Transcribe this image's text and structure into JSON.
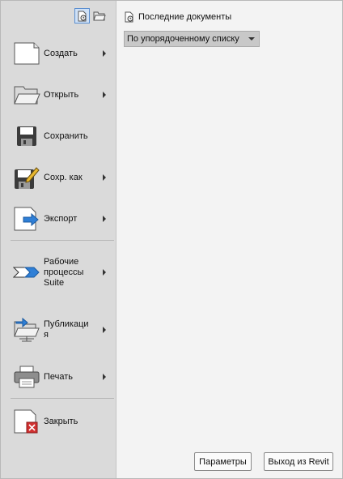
{
  "menu": {
    "items": [
      {
        "label": "Создать",
        "icon": "new-document-icon",
        "submenu": true
      },
      {
        "label": "Открыть",
        "icon": "open-folder-icon",
        "submenu": true
      },
      {
        "label": "Сохранить",
        "icon": "save-disk-icon",
        "submenu": false
      },
      {
        "label": "Сохр. как",
        "icon": "save-as-icon",
        "submenu": true
      },
      {
        "label": "Экспорт",
        "icon": "export-icon",
        "submenu": true
      },
      {
        "label": "Рабочие\nпроцессы\nSuite",
        "icon": "suite-workflows-icon",
        "submenu": true
      },
      {
        "label": "Публикаци\nя",
        "icon": "publish-icon",
        "submenu": true
      },
      {
        "label": "Печать",
        "icon": "printer-icon",
        "submenu": true
      },
      {
        "label": "Закрыть",
        "icon": "close-document-icon",
        "submenu": false
      }
    ]
  },
  "recent": {
    "title": "Последние документы",
    "sort_selected": "По упорядоченному списку"
  },
  "buttons": {
    "options": "Параметры",
    "exit": "Выход из Revit"
  },
  "colors": {
    "menu_bg": "#dadada",
    "pane_bg": "#f3f3f3",
    "accent_blue": "#2f7fd6",
    "close_red": "#d03030"
  }
}
